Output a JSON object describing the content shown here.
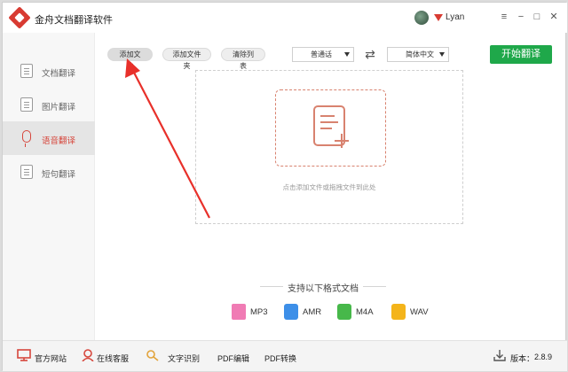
{
  "app": {
    "title": "金舟文档翻译软件",
    "user": "Lyan"
  },
  "window_controls": {
    "menu": "≡",
    "minimize": "−",
    "maximize": "□",
    "close": "✕"
  },
  "sidebar": {
    "items": [
      {
        "label": "文档翻译",
        "icon": "document-icon",
        "active": false
      },
      {
        "label": "图片翻译",
        "icon": "image-icon",
        "active": false
      },
      {
        "label": "语音翻译",
        "icon": "microphone-icon",
        "active": true
      },
      {
        "label": "短句翻译",
        "icon": "text-icon",
        "active": false
      }
    ]
  },
  "toolbar": {
    "add_file": "添加文件",
    "add_folder": "添加文件夹",
    "clear_list": "清除列表",
    "source_language": "普通话",
    "target_language": "简体中文",
    "swap_icon": "⇄",
    "start": "开始翻译"
  },
  "drop_area": {
    "hint": "点击添加文件或拖拽文件到此处"
  },
  "formats": {
    "title": "支持以下格式文档",
    "items": [
      {
        "name": "MP3",
        "color": "#f07bb4"
      },
      {
        "name": "AMR",
        "color": "#3d8fe8"
      },
      {
        "name": "M4A",
        "color": "#47b84a"
      },
      {
        "name": "WAV",
        "color": "#f4b41a"
      }
    ]
  },
  "statusbar": {
    "website": "官方网站",
    "service": "在线客服",
    "ocr": "文字识别",
    "pdf_edit": "PDF编辑",
    "pdf_convert": "PDF转换",
    "version_label": "版本：",
    "version": "2.8.9"
  },
  "colors": {
    "accent": "#d6463c",
    "start_button": "#1fa84a",
    "annotation_arrow": "#e8302a"
  }
}
